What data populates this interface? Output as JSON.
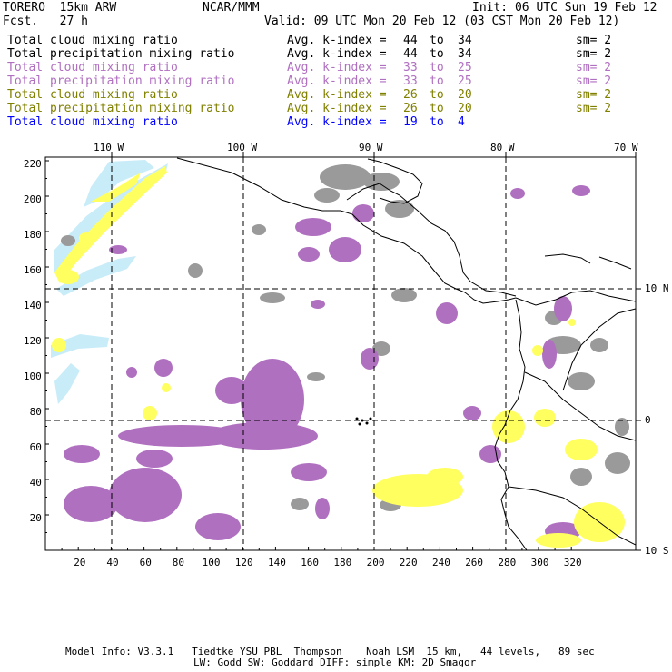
{
  "header": {
    "title": "TORERO  15km ARW",
    "center": "NCAR/MMM",
    "init": "Init: 06 UTC Sun 19 Feb 12",
    "fcst": "Fcst.   27 h",
    "valid": "Valid: 09 UTC Mon 20 Feb 12 (03 CST Mon 20 Feb 12)"
  },
  "legend": [
    {
      "field": "Total cloud mixing ratio",
      "kindex": "Avg. k-index =",
      "from": "44",
      "to_word": "to",
      "to": "34",
      "sm": "sm= 2",
      "color": "#000000"
    },
    {
      "field": "Total precipitation mixing ratio",
      "kindex": "Avg. k-index =",
      "from": "44",
      "to_word": "to",
      "to": "34",
      "sm": "sm= 2",
      "color": "#000000"
    },
    {
      "field": "Total cloud mixing ratio",
      "kindex": "Avg. k-index =",
      "from": "33",
      "to_word": "to",
      "to": "25",
      "sm": "sm= 2",
      "color": "#b070c0"
    },
    {
      "field": "Total precipitation mixing ratio",
      "kindex": "Avg. k-index =",
      "from": "33",
      "to_word": "to",
      "to": "25",
      "sm": "sm= 2",
      "color": "#b070c0"
    },
    {
      "field": "Total cloud mixing ratio",
      "kindex": "Avg. k-index =",
      "from": "26",
      "to_word": "to",
      "to": "20",
      "sm": "sm= 2",
      "color": "#808000"
    },
    {
      "field": "Total precipitation mixing ratio",
      "kindex": "Avg. k-index =",
      "from": "26",
      "to_word": "to",
      "to": "20",
      "sm": "sm= 2",
      "color": "#808000"
    },
    {
      "field": "Total cloud mixing ratio",
      "kindex": "Avg. k-index =",
      "from": "19",
      "to_word": "to",
      "to": "4",
      "sm": "",
      "color": "#0000ff"
    }
  ],
  "axes": {
    "lon_labels": [
      "110 W",
      "100 W",
      "90 W",
      "80 W",
      "70 W"
    ],
    "lat_labels": [
      "10 N",
      "0",
      "10 S"
    ],
    "x_ticks": [
      "20",
      "40",
      "60",
      "80",
      "100",
      "120",
      "140",
      "160",
      "180",
      "200",
      "220",
      "240",
      "260",
      "280",
      "300",
      "320"
    ],
    "y_ticks": [
      "220",
      "200",
      "180",
      "160",
      "140",
      "120",
      "100",
      "80",
      "60",
      "40",
      "20"
    ]
  },
  "colors": {
    "gray": "#9a9a9a",
    "purple": "#b070c0",
    "yellow": "#ffff60",
    "lightblue": "#c8ecf8",
    "coast": "#000000"
  },
  "footer": {
    "line1": "Model Info: V3.3.1   Tiedtke YSU PBL  Thompson    Noah LSM  15 km,   44 levels,   89 sec",
    "line2": "LW: Godd SW: Goddard DIFF: simple KM: 2D Smagor"
  }
}
